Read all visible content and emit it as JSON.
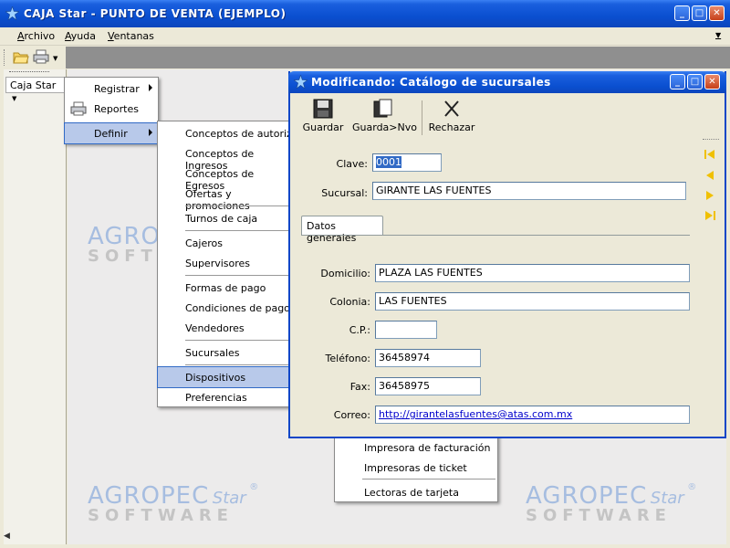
{
  "app": {
    "title": "CAJA Star - PUNTO DE VENTA (EJEMPLO)"
  },
  "menubar": {
    "items": [
      "Archivo",
      "Ayuda",
      "Ventanas"
    ]
  },
  "left_panel": {
    "tab_label": "Caja Star"
  },
  "menu1": {
    "items": [
      "Registrar",
      "Reportes",
      "Definir"
    ]
  },
  "menu2": {
    "items": [
      "Conceptos de autorización",
      "Conceptos de Ingresos",
      "Conceptos de Egresos",
      "Ofertas y promociones",
      "Turnos de caja",
      "Cajeros",
      "Supervisores",
      "Formas de pago",
      "Condiciones de pago",
      "Vendedores",
      "Sucursales",
      "Dispositivos",
      "Preferencias"
    ]
  },
  "menu3": {
    "items": [
      "Impresora de facturación",
      "Impresoras de ticket",
      "Lectoras de tarjeta"
    ]
  },
  "watermark": {
    "brand": "AGROPEC",
    "star": "Star",
    "reg": "®",
    "software": "SOFTWARE"
  },
  "child": {
    "title": "Modificando: Catálogo de sucursales",
    "toolbar": {
      "save": "Guardar",
      "save_new": "Guarda>Nvo",
      "reject": "Rechazar"
    },
    "fields": {
      "clave_label": "Clave:",
      "clave_value": "0001",
      "sucursal_label": "Sucursal:",
      "sucursal_value": "GIRANTE LAS FUENTES",
      "tab_label": "Datos generales",
      "domicilio_label": "Domicilio:",
      "domicilio_value": "PLAZA LAS FUENTES",
      "colonia_label": "Colonia:",
      "colonia_value": "LAS FUENTES",
      "cp_label": "C.P.:",
      "cp_value": "",
      "telefono_label": "Teléfono:",
      "telefono_value": "36458974",
      "fax_label": "Fax:",
      "fax_value": "36458975",
      "correo_label": "Correo:",
      "correo_value": "http://girantelasfuentes@atas.com.mx"
    }
  },
  "colors": {
    "title_blue": "#0a4fd0",
    "highlight": "#b8c9ea",
    "nav_arrow": "#f0c000"
  }
}
